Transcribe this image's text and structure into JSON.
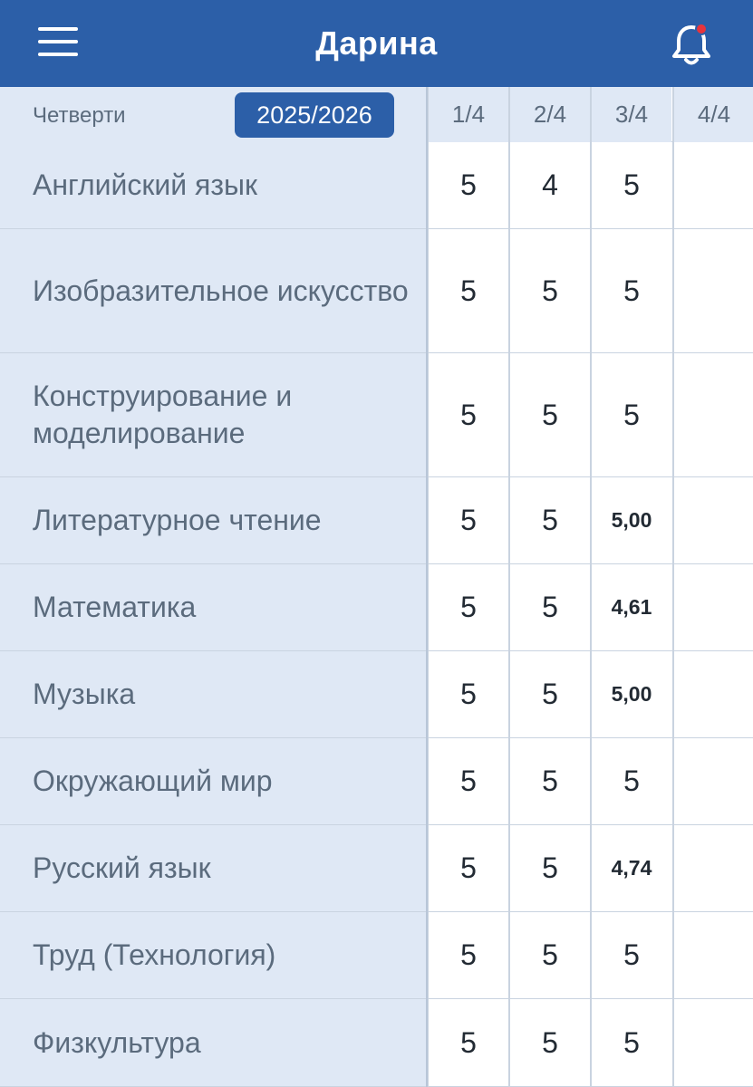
{
  "header": {
    "title": "Дарина",
    "icons": {
      "menu": "menu-icon",
      "notifications": "bell-icon"
    },
    "notification_dot_color": "#e8343c"
  },
  "table": {
    "quarters_label": "Четверти",
    "school_year": "2025/2026",
    "columns": [
      "1/4",
      "2/4",
      "3/4",
      "4/4"
    ],
    "rows": [
      {
        "subject": "Английский язык",
        "grades": [
          "5",
          "4",
          "5",
          ""
        ]
      },
      {
        "subject": "Изобразительное искусство",
        "grades": [
          "5",
          "5",
          "5",
          ""
        ]
      },
      {
        "subject": "Конструирование и моделирование",
        "grades": [
          "5",
          "5",
          "5",
          ""
        ]
      },
      {
        "subject": "Литературное чтение",
        "grades": [
          "5",
          "5",
          "5,00",
          ""
        ]
      },
      {
        "subject": "Математика",
        "grades": [
          "5",
          "5",
          "4,61",
          ""
        ]
      },
      {
        "subject": "Музыка",
        "grades": [
          "5",
          "5",
          "5,00",
          ""
        ]
      },
      {
        "subject": "Окружающий мир",
        "grades": [
          "5",
          "5",
          "5",
          ""
        ]
      },
      {
        "subject": "Русский язык",
        "grades": [
          "5",
          "5",
          "4,74",
          ""
        ]
      },
      {
        "subject": "Труд (Технология)",
        "grades": [
          "5",
          "5",
          "5",
          ""
        ]
      },
      {
        "subject": "Физкультура",
        "grades": [
          "5",
          "5",
          "5",
          ""
        ]
      }
    ]
  },
  "colors": {
    "appbar": "#2c5fa8",
    "subject_bg": "#dfe8f5",
    "subject_text": "#5b6b7d",
    "grade_text": "#222a33"
  }
}
